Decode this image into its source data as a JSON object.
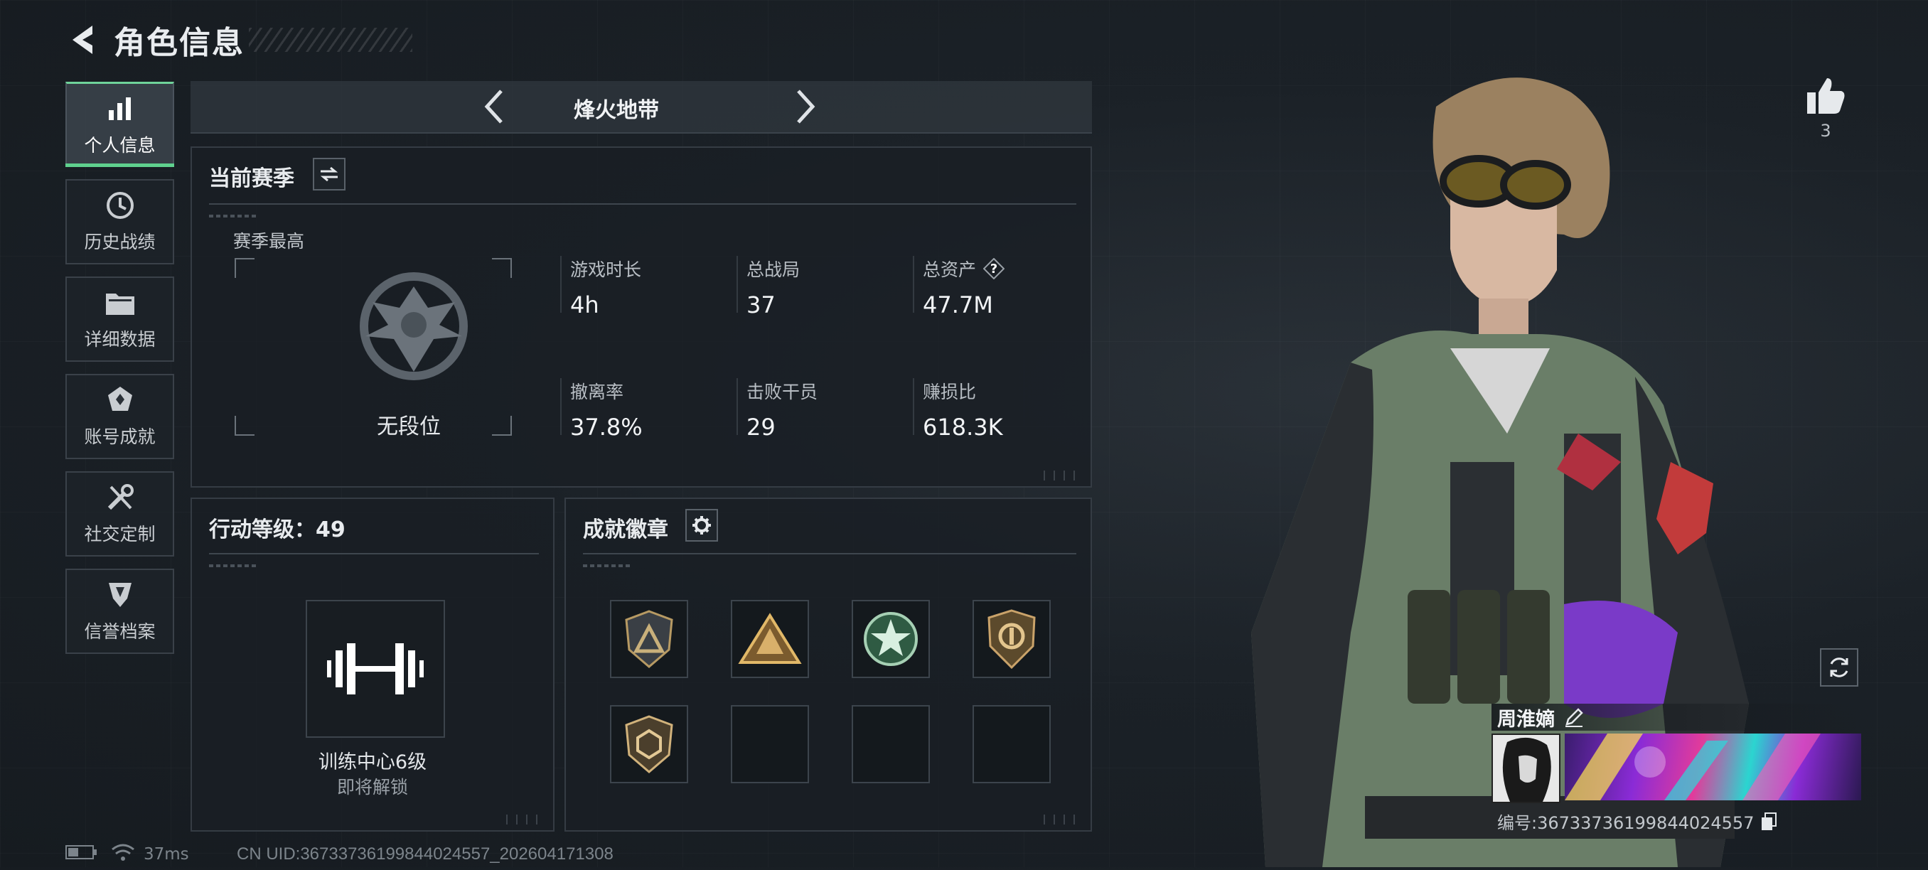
{
  "header": {
    "title": "角色信息"
  },
  "sidebar": {
    "items": [
      {
        "label": "个人信息",
        "icon": "bar-chart-icon",
        "active": true
      },
      {
        "label": "历史战绩",
        "icon": "history-icon"
      },
      {
        "label": "详细数据",
        "icon": "folder-icon"
      },
      {
        "label": "账号成就",
        "icon": "achievement-icon"
      },
      {
        "label": "社交定制",
        "icon": "tools-icon"
      },
      {
        "label": "信誉档案",
        "icon": "credit-shield-icon"
      }
    ]
  },
  "mode": {
    "name": "烽火地带"
  },
  "season": {
    "title": "当前赛季",
    "best_label": "赛季最高",
    "rank": "无段位",
    "stats": [
      {
        "label": "游戏时长",
        "value": "4h"
      },
      {
        "label": "总战局",
        "value": "37"
      },
      {
        "label": "总资产",
        "value": "47.7M",
        "help": "?"
      },
      {
        "label": "撤离率",
        "value": "37.8%"
      },
      {
        "label": "击败干员",
        "value": "29"
      },
      {
        "label": "赚损比",
        "value": "618.3K"
      }
    ]
  },
  "level": {
    "title": "行动等级：49",
    "name": "训练中心6级",
    "sub": "即将解锁"
  },
  "badges": {
    "title": "成就徽章",
    "items": [
      "triangle-badge-icon",
      "pyramid-badge-icon",
      "star-wreath-badge-icon",
      "circle-shield-badge-icon",
      "hexagon-badge-icon"
    ],
    "empty_slots": 3
  },
  "status": {
    "ping": "37ms",
    "uid": "CN UID:3673373619984402455​7_202604171308"
  },
  "profile": {
    "likes": "3",
    "player_name": "周淮嫡",
    "player_id": "编号:3673373619984402455​7"
  },
  "colors": {
    "accent": "#5fd08e",
    "panel_bg": "#1a1f25",
    "border": "#353c44"
  }
}
